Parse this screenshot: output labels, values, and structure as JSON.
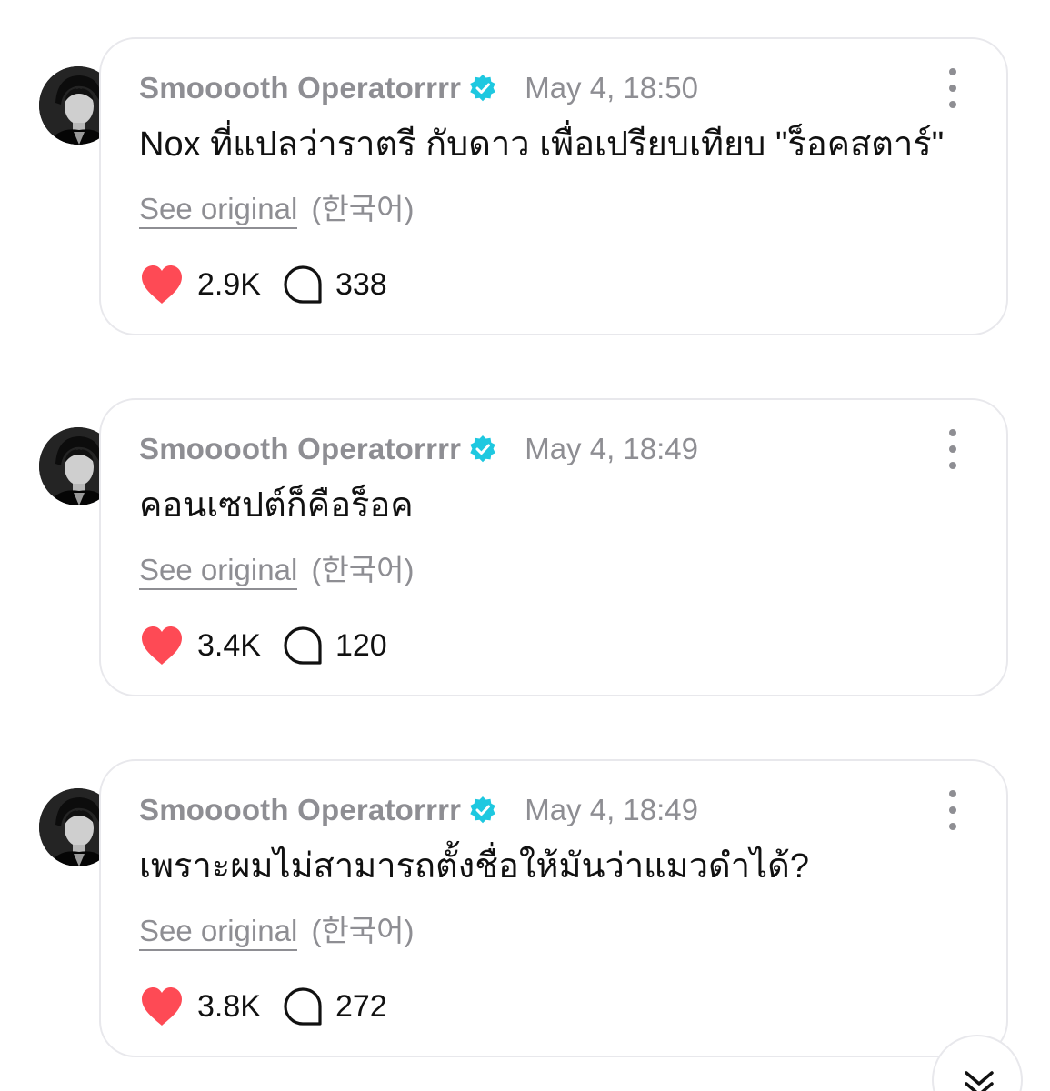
{
  "colors": {
    "accent_verified": "#1ec8e0",
    "like": "#fe4a55",
    "muted": "#8e8e93",
    "border": "#e8e8ec"
  },
  "posts": [
    {
      "author": "Smooooth Operatorrrr",
      "time": "May 4, 18:50",
      "text": "Nox ที่แปลว่าราตรี กับดาว เพื่อเปรียบเทียบ \"ร็อคสตาร์\"",
      "see_original": "See original",
      "language": "(한국어)",
      "likes": "2.9K",
      "replies": "338"
    },
    {
      "author": "Smooooth Operatorrrr",
      "time": "May 4, 18:49",
      "text": "คอนเซปต์ก็คือร็อค",
      "see_original": "See original",
      "language": "(한국어)",
      "likes": "3.4K",
      "replies": "120"
    },
    {
      "author": "Smooooth Operatorrrr",
      "time": "May 4, 18:49",
      "text": "เพราะผมไม่สามารถตั้งชื่อให้มันว่าแมวดำได้?",
      "see_original": "See original",
      "language": "(한국어)",
      "likes": "3.8K",
      "replies": "272"
    }
  ],
  "icons": {
    "verified": "verified-badge-icon",
    "more": "more-vertical-icon",
    "like": "heart-icon",
    "reply": "speech-bubble-icon",
    "scroll": "chevron-double-down-icon"
  }
}
